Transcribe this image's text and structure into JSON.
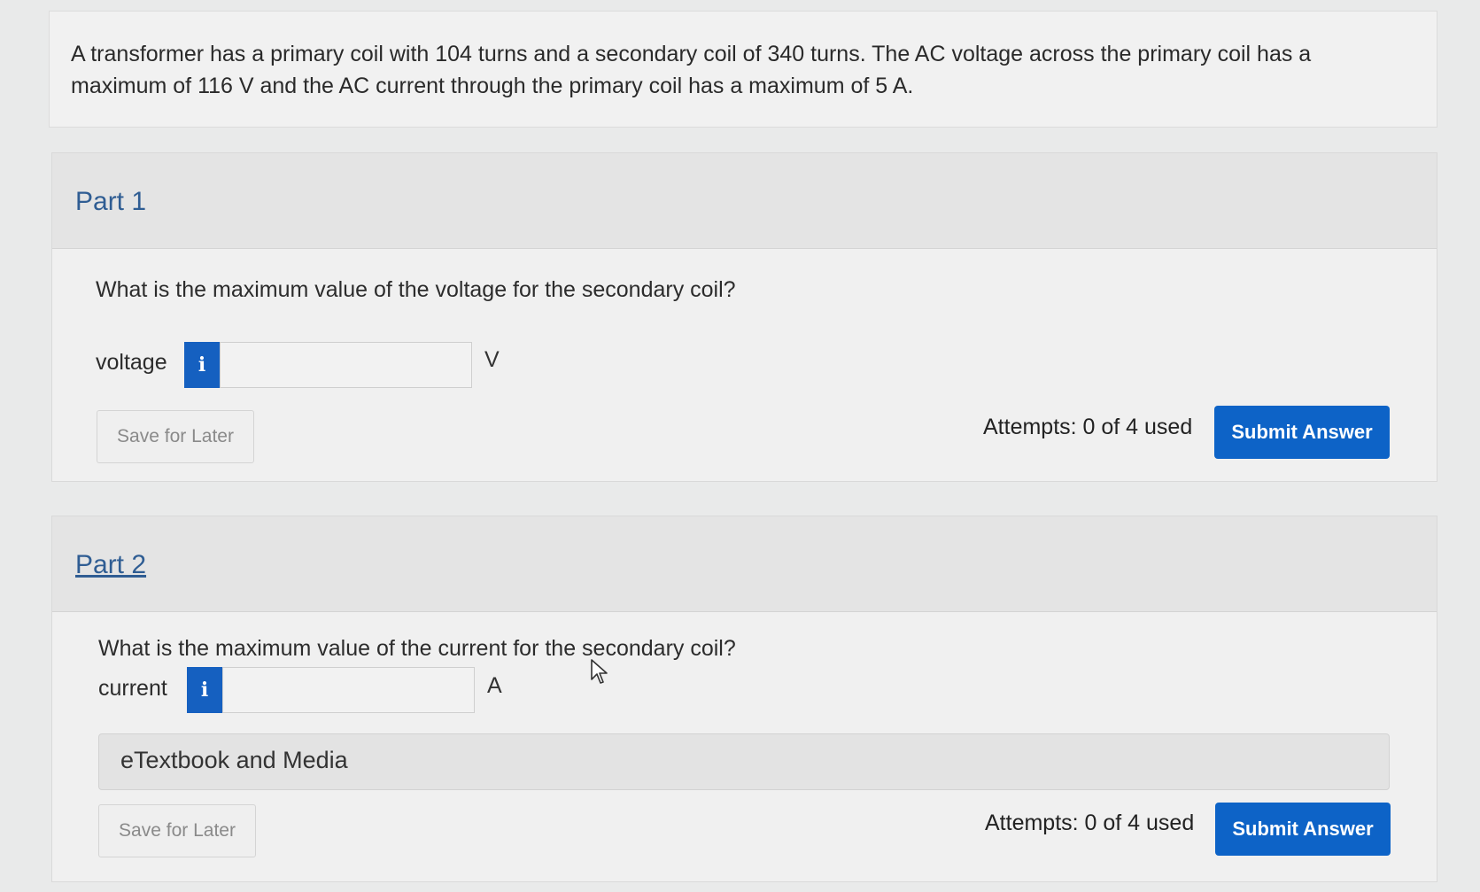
{
  "question": {
    "text": "A transformer has a primary coil with 104 turns and a secondary coil of 340 turns. The AC voltage across the primary coil has a maximum of 116 V and the AC current through the primary coil has a maximum of 5 A."
  },
  "part1": {
    "title": "Part 1",
    "prompt": "What is the maximum value of the voltage for the secondary coil?",
    "field_label": "voltage",
    "info_glyph": "i",
    "input_value": "",
    "unit": "V",
    "save_label": "Save for Later",
    "attempts": "Attempts: 0 of 4 used",
    "submit_label": "Submit Answer"
  },
  "part2": {
    "title": "Part 2",
    "prompt": "What is the maximum value of the current for the secondary coil?",
    "field_label": "current",
    "info_glyph": "i",
    "input_value": "",
    "unit": "A",
    "media_label": "eTextbook and Media",
    "save_label": "Save for Later",
    "attempts": "Attempts: 0 of 4 used",
    "submit_label": "Submit Answer"
  },
  "colors": {
    "accent": "#0d63c7",
    "link": "#2f5d93",
    "info_button": "#1560c0"
  },
  "icons": {
    "info": "info-icon",
    "cursor": "mouse-pointer-icon"
  }
}
